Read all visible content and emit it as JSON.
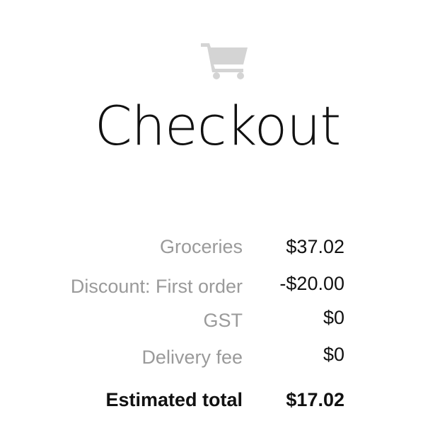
{
  "icons": {
    "cart": "shopping-cart-icon"
  },
  "colors": {
    "icon": "#d4d4d4",
    "label": "#9a9a9a",
    "text": "#111111"
  },
  "page": {
    "title": "Checkout"
  },
  "summary": {
    "rows": [
      {
        "label": "Groceries",
        "value": "$37.02"
      },
      {
        "label": "Discount: First order",
        "value": "-$20.00"
      },
      {
        "label": "GST",
        "value": "$0"
      },
      {
        "label": "Delivery fee",
        "value": "$0"
      }
    ],
    "total": {
      "label": "Estimated total",
      "value": "$17.02"
    }
  }
}
